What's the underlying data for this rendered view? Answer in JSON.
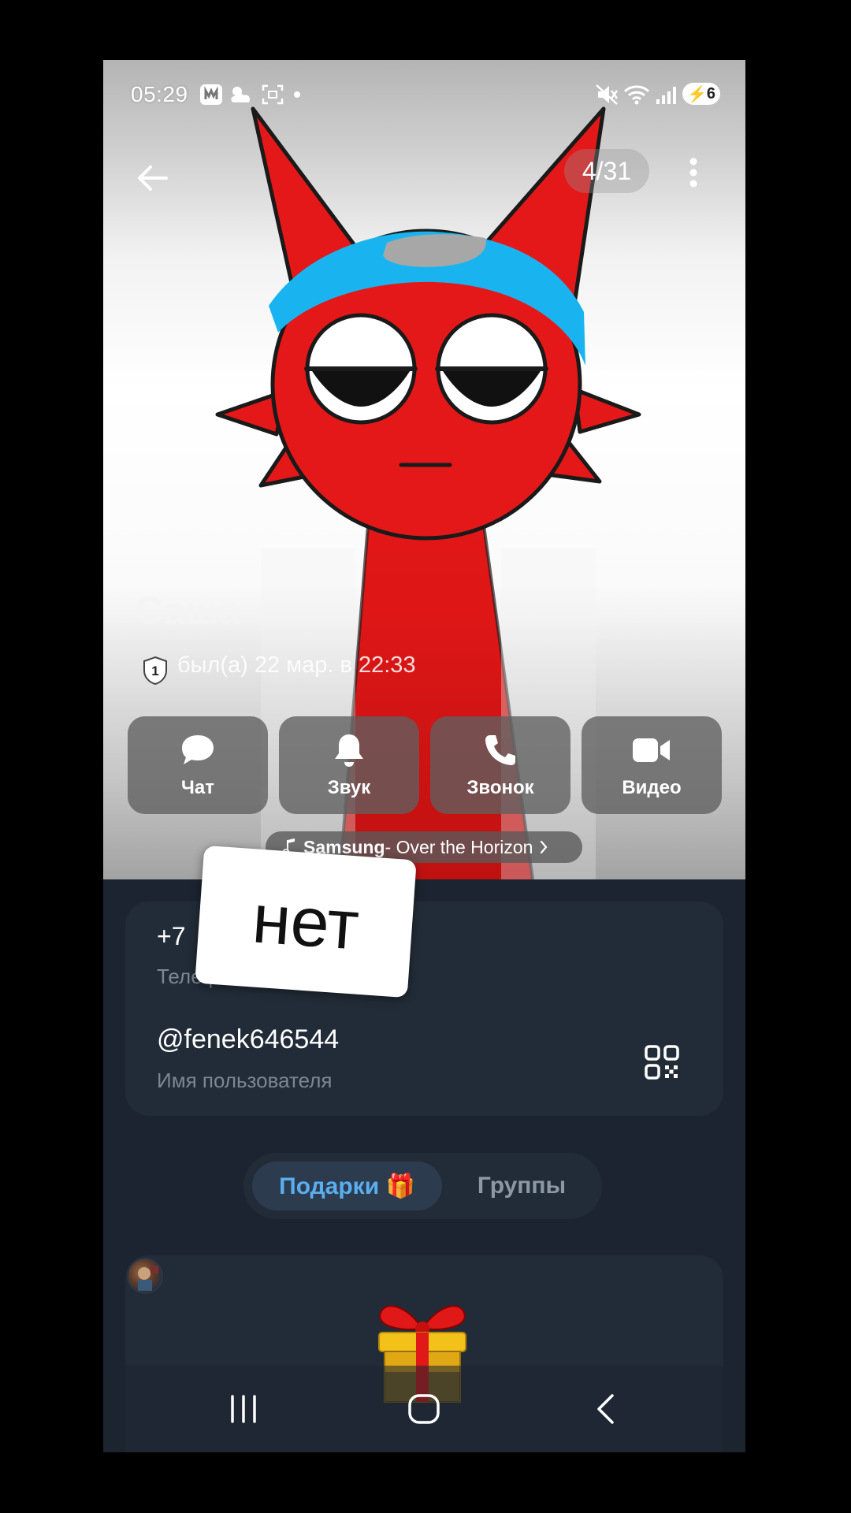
{
  "status_bar": {
    "time": "05:29",
    "battery": "6",
    "icons": [
      "notification-icon",
      "weather-icon",
      "screenshot-icon",
      "dot-icon",
      "mute-icon",
      "wifi-icon",
      "signal-icon",
      "battery-icon"
    ]
  },
  "top_bar": {
    "back_icon": "arrow-left-icon",
    "photo_counter": "4/31",
    "more_icon": "more-vertical-icon"
  },
  "profile": {
    "name": "Саша",
    "badge_number": "1",
    "last_seen": "был(а) 22 мар. в 22:33"
  },
  "actions": [
    {
      "label": "Чат",
      "icon": "chat-icon"
    },
    {
      "label": "Звук",
      "icon": "bell-icon"
    },
    {
      "label": "Звонок",
      "icon": "phone-icon"
    },
    {
      "label": "Видео",
      "icon": "video-icon"
    }
  ],
  "music": {
    "icon": "music-note-icon",
    "artist": "Samsung",
    "title": " - Over the Horizon"
  },
  "info": {
    "phone_value": "+7",
    "phone_label": "Телефон",
    "username_value": "@fenek646544",
    "username_label": "Имя пользователя",
    "qr_icon": "qr-code-icon"
  },
  "sticker": {
    "text": "нет"
  },
  "tabs": [
    {
      "label": "Подарки 🎁",
      "active": true
    },
    {
      "label": "Группы",
      "active": false
    }
  ],
  "gift": {
    "icon": "gift-icon"
  },
  "nav_bar": {
    "icons": [
      "recent-apps-icon",
      "home-icon",
      "back-icon"
    ]
  },
  "colors": {
    "background": "#1b2430",
    "card": "#222c38",
    "accent": "#5aaef0",
    "muted_text": "#7b8793",
    "character_red": "#e41818",
    "headband_blue": "#19b4f0"
  }
}
